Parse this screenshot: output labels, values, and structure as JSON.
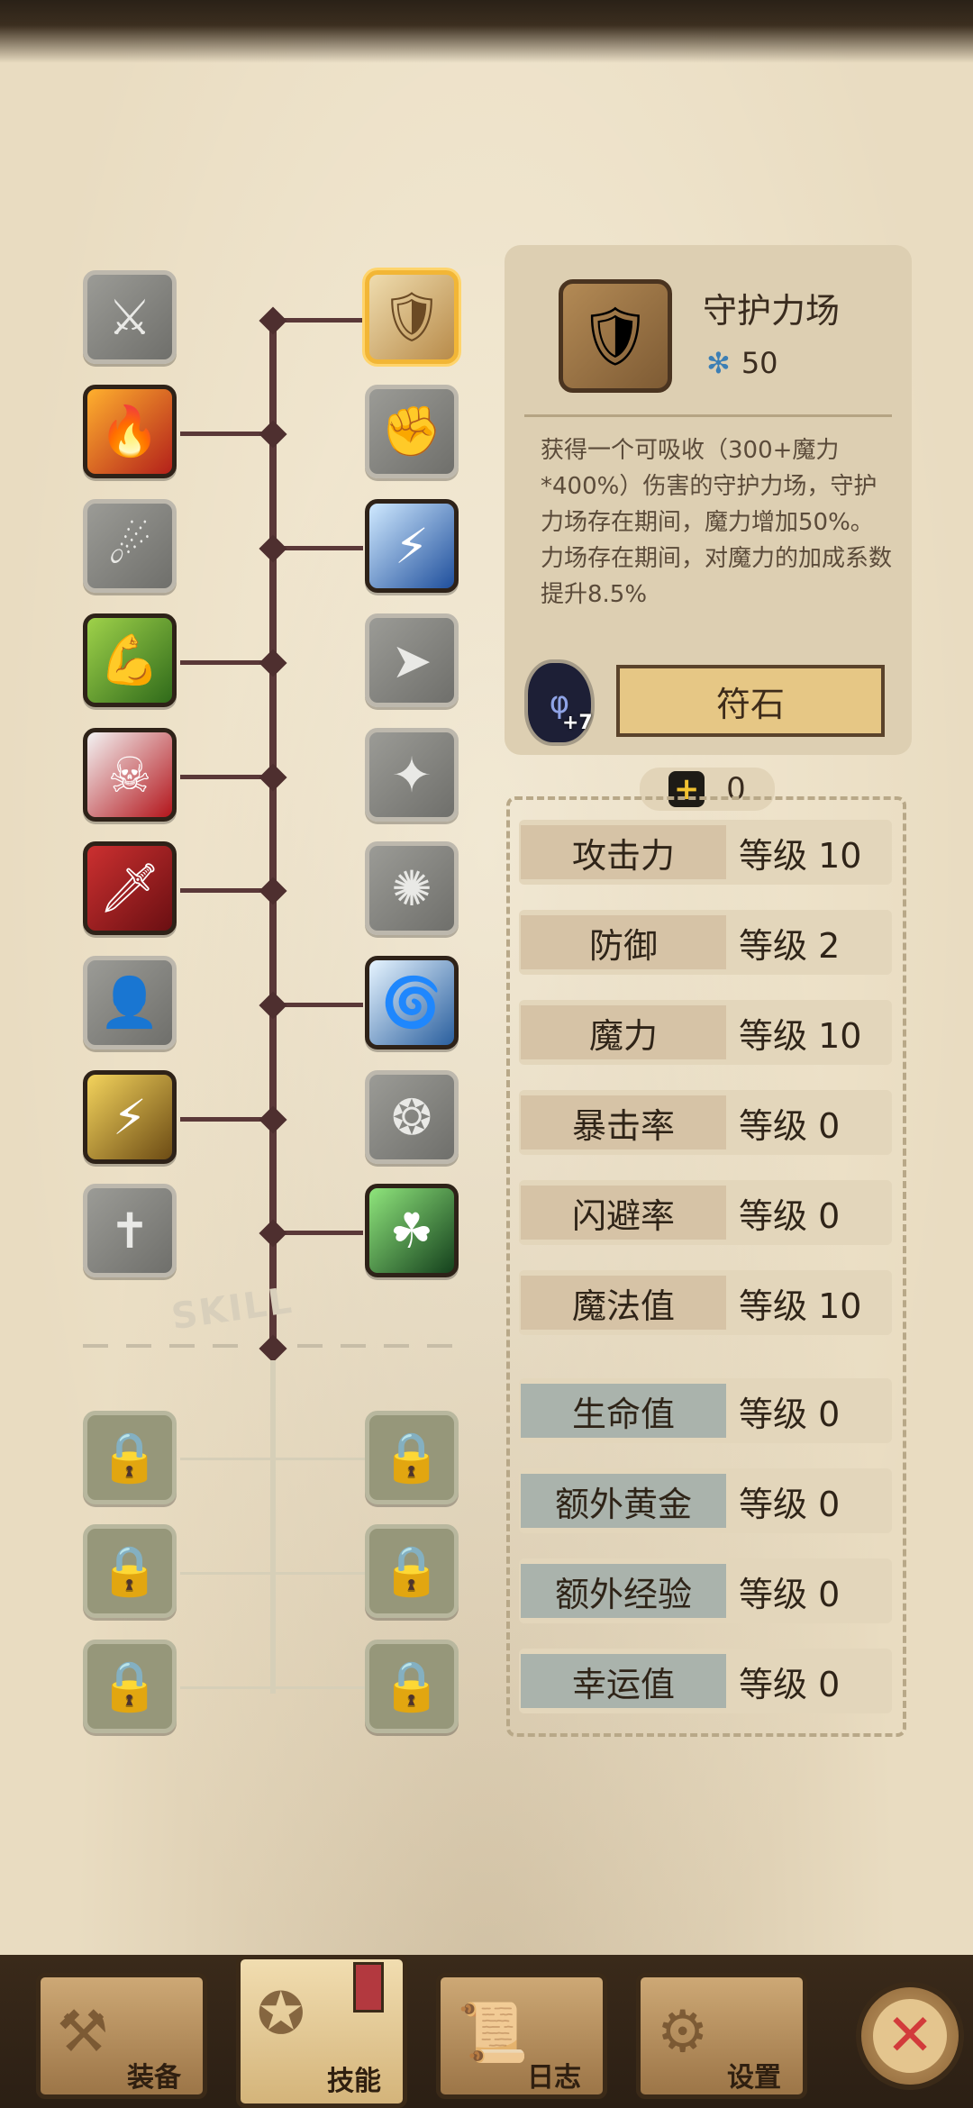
{
  "selected_skill": {
    "name": "守护力场",
    "cost": "50",
    "description": "获得一个可吸收（300+魔力*400%）伤害的守护力场，守护力场存在期间，魔力增加50%。\n力场存在期间，对魔力的加成系数提升8.5%",
    "rune_count": "+7",
    "rune_button": "符石"
  },
  "skill_tree_label": "SKILL",
  "points": "0",
  "stats": [
    {
      "name": "攻击力",
      "level": "等级 10"
    },
    {
      "name": "防御",
      "level": "等级 2"
    },
    {
      "name": "魔力",
      "level": "等级 10"
    },
    {
      "name": "暴击率",
      "level": "等级 0"
    },
    {
      "name": "闪避率",
      "level": "等级 0"
    },
    {
      "name": "魔法值",
      "level": "等级 10"
    },
    {
      "name": "生命值",
      "level": "等级 0"
    },
    {
      "name": "额外黄金",
      "level": "等级 0"
    },
    {
      "name": "额外经验",
      "level": "等级 0"
    },
    {
      "name": "幸运值",
      "level": "等级 0"
    }
  ],
  "tabs": [
    {
      "label": "装备",
      "icon": "axe-icon"
    },
    {
      "label": "技能",
      "icon": "skill-icon"
    },
    {
      "label": "日志",
      "icon": "book-icon"
    },
    {
      "label": "设置",
      "icon": "gear-icon"
    }
  ],
  "colors": {
    "selected_border": "#f2b636",
    "tree_line": "#5a3838",
    "close_x": "#d23b3b"
  }
}
